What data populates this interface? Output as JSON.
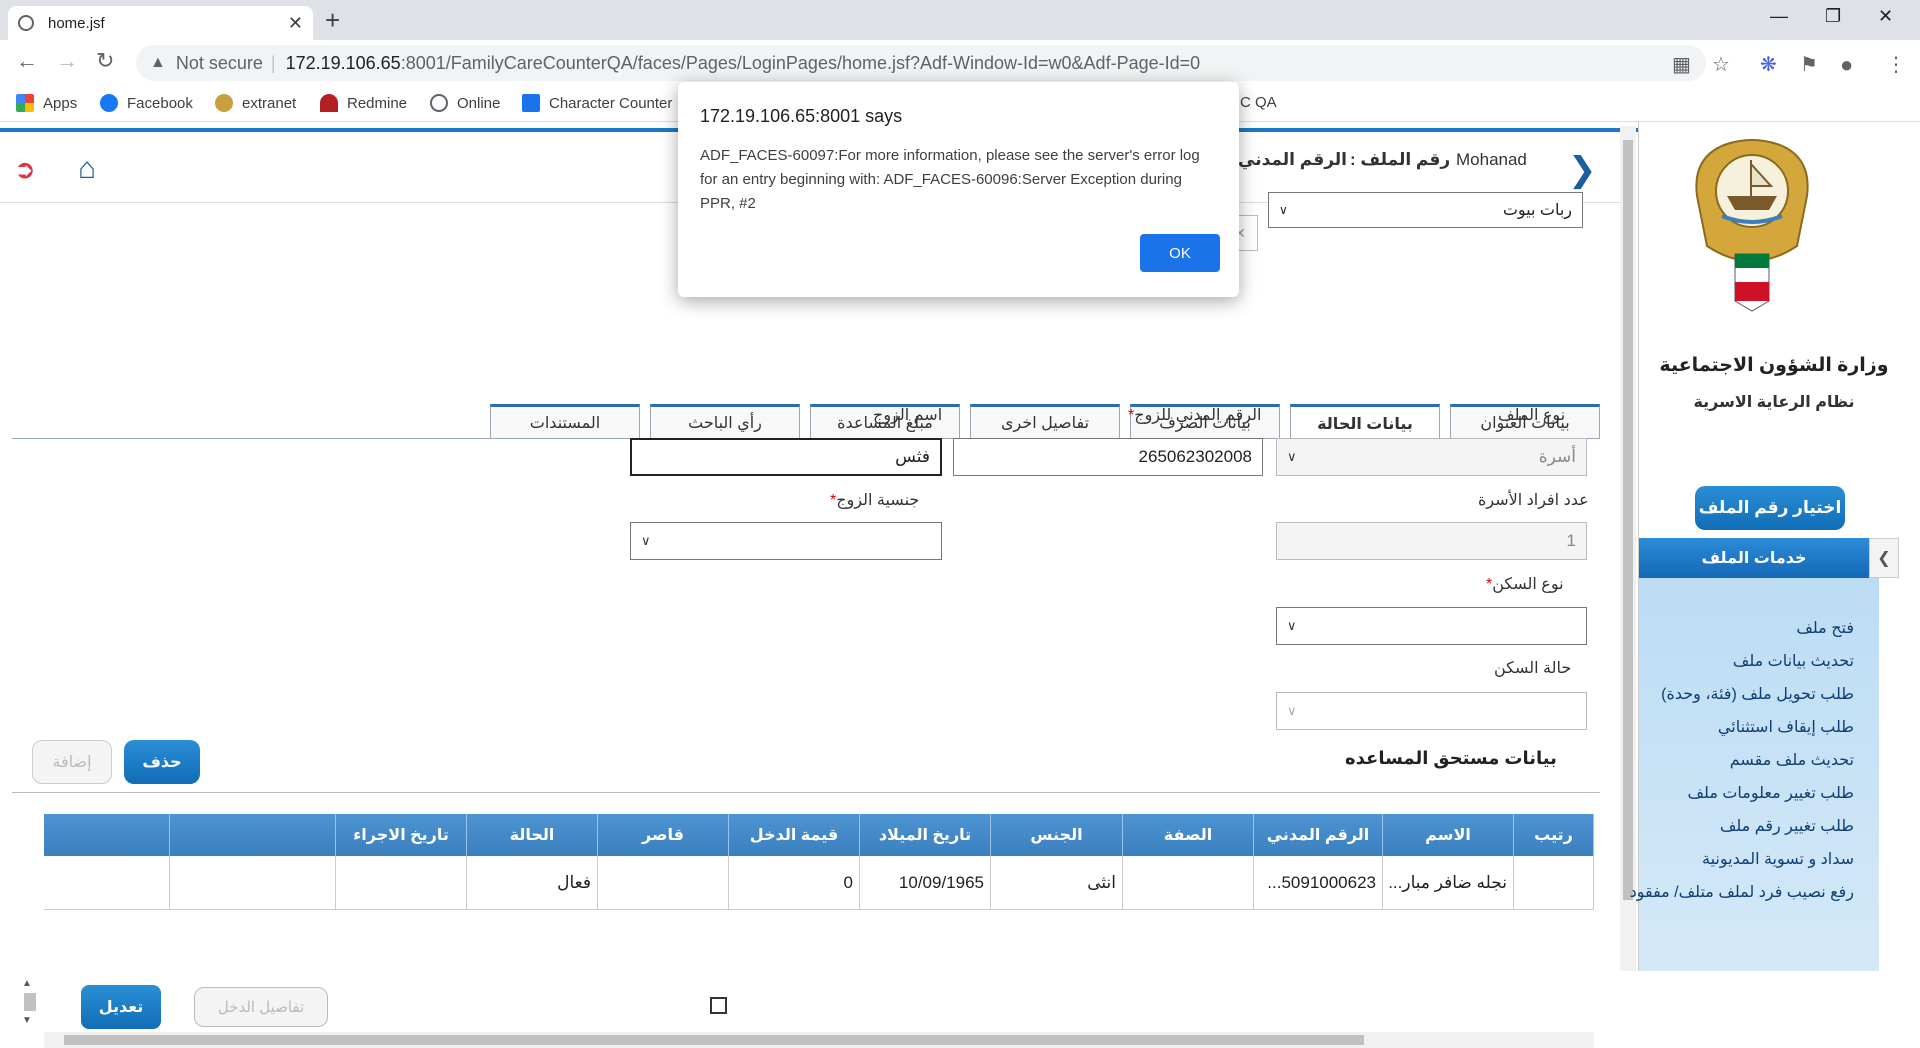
{
  "browser": {
    "tab_title": "home.jsf",
    "tab_close": "✕",
    "new_tab": "+",
    "security_label": "Not secure",
    "url_host": "172.19.106.65",
    "url_rest": ":8001/FamilyCareCounterQA/faces/Pages/LoginPages/home.jsf?Adf-Window-Id=w0&Adf-Page-Id=0",
    "bookmarks": [
      "Apps",
      "Facebook",
      "extranet",
      "Redmine",
      "Online",
      "Character Counter",
      "C QA"
    ]
  },
  "header": {
    "user_name": "Mohanad",
    "file_no_label": "رقم الملف :",
    "civil_id_label": "الرقم المدني"
  },
  "search": {
    "selected": "ربات بيوت"
  },
  "sidebar": {
    "ministry": "وزارة الشؤون الاجتماعية",
    "system": "نظام الرعاية الاسرية",
    "choose_file": "اختيار رقم الملف",
    "services_title": "خدمات الملف",
    "services": [
      "فتح ملف",
      "تحديث بيانات ملف",
      "طلب تحويل ملف (فئة، وحدة)",
      "طلب إيقاف استثنائي",
      "تحديث ملف مقسم",
      "طلب تغيير معلومات ملف",
      "طلب تغيير رقم ملف",
      "سداد و تسوية المديونية",
      "رفع نصيب فرد لملف متلف/ مفقود"
    ]
  },
  "tabs": [
    "بيانات العنوان",
    "بيانات الحالة",
    "بيانات الصرف",
    "تفاصيل اخرى",
    "مبلغ المساعدة",
    "رأي الباحث",
    "المستندات"
  ],
  "form": {
    "file_type_label": "نوع الملف",
    "file_type_value": "أسرة",
    "husband_civil_label": "الرقم المدني للزوج",
    "husband_civil_value": "265062302008",
    "husband_name_label": "اسم الزوج",
    "husband_name_value": "فثس",
    "family_count_label": "عدد افراد الأسرة",
    "family_count_value": "1",
    "husband_nat_label": "جنسية الزوج",
    "housing_type_label": "نوع السكن",
    "housing_status_label": "حالة السكن",
    "required_mark": "*"
  },
  "beneficiaries": {
    "title": "بيانات مستحق المساعده",
    "delete_label": "حذف",
    "add_label": "إضافة",
    "columns": [
      "رتيب",
      "الاسم",
      "الرقم المدني",
      "الصفة",
      "الجنس",
      "تاريخ الميلاد",
      "قيمة الدخل",
      "قاصر",
      "الحالة",
      "تاريخ الاجراء",
      "",
      ""
    ],
    "row": {
      "name": "نجله ضافر مبار...",
      "civil": "5091000623...",
      "relation": "",
      "gender": "انثى",
      "dob": "10/09/1965",
      "income": "0",
      "status": "فعال",
      "action_date": "",
      "income_details": "تفاصيل الدخل",
      "edit": "تعديل"
    }
  },
  "dialog": {
    "title": "172.19.106.65:8001 says",
    "message": "ADF_FACES-60097:For more information, please see the server's error log for an entry beginning with: ADF_FACES-60096:Server Exception during PPR, #2",
    "ok": "OK"
  }
}
